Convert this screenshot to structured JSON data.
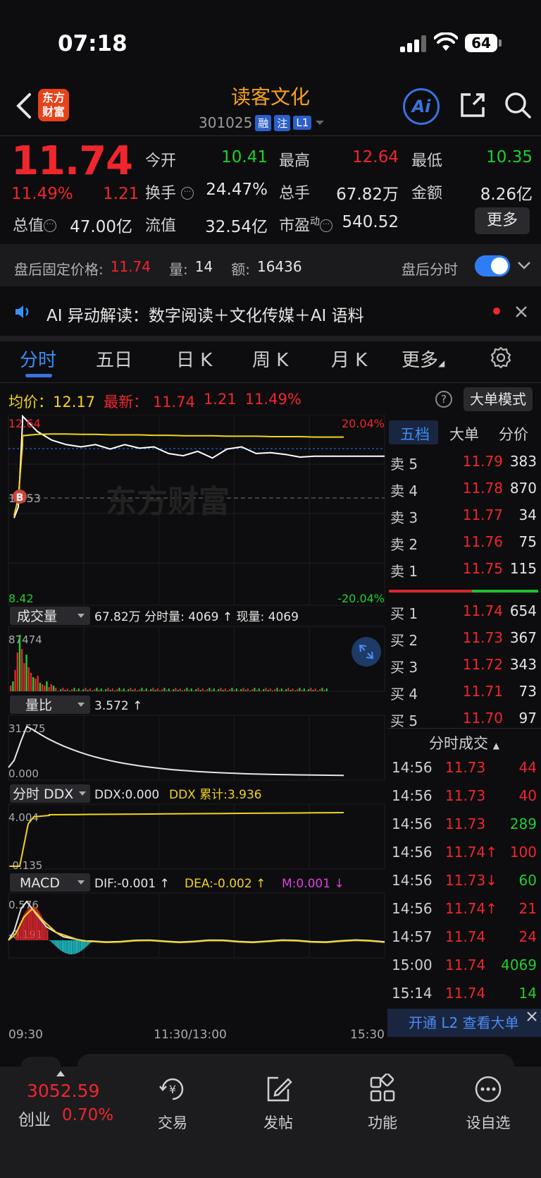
{
  "status_bar": {
    "time": "07:18",
    "battery": "64"
  },
  "header": {
    "logo_text_1": "东方",
    "logo_text_2": "财富",
    "stock_name": "读客文化",
    "stock_code": "301025",
    "tags": [
      "融",
      "注",
      "L1"
    ],
    "ai_label": "Ai"
  },
  "quote": {
    "price": "11.74",
    "change_pct": "11.49%",
    "change": "1.21",
    "open_label": "今开",
    "open": "10.41",
    "high_label": "最高",
    "high": "12.64",
    "low_label": "最低",
    "low": "10.35",
    "turnover_label": "换手",
    "turnover": "24.47%",
    "volume_label": "总手",
    "volume": "67.82万",
    "amount_label": "金额",
    "amount": "8.26亿",
    "mcap_label": "总值",
    "mcap": "47.00亿",
    "float_label": "流值",
    "float": "32.54亿",
    "pe_label": "市盈",
    "pe_sup": "动",
    "pe": "540.52",
    "more": "更多"
  },
  "after_hours": {
    "label": "盘后固定价格:",
    "price": "11.74",
    "vol_label": "量:",
    "vol": "14",
    "amt_label": "额:",
    "amt": "16436",
    "toggle_label": "盘后分时"
  },
  "ai_banner": {
    "text": "AI 异动解读：数字阅读＋文化传媒＋AI 语料"
  },
  "tabs": [
    "分时",
    "五日",
    "日 K",
    "周 K",
    "月 K",
    "更多"
  ],
  "info": {
    "avg_label": "均价：",
    "avg": "12.17",
    "latest_label": "最新：",
    "latest": "11.74",
    "chg": "1.21",
    "pct": "11.49%",
    "help": "?",
    "big_order_mode": "大单模式"
  },
  "chart_data": [
    {
      "type": "line",
      "name": "分时",
      "ylim": [
        8.42,
        12.64
      ],
      "ytick_left": [
        "12.64",
        "10.53",
        "8.42"
      ],
      "ytick_right": [
        "20.04%",
        "-20.04%"
      ],
      "marker": "B",
      "watermark": "东方财富",
      "x_labels": [
        "09:30",
        "11:30/13:00",
        "15:30"
      ],
      "series": [
        {
          "name": "price",
          "values": [
            10.35,
            10.6,
            12.5,
            12.64,
            12.3,
            12.1,
            12.0,
            11.95,
            12.0,
            11.9,
            12.0,
            11.92,
            11.95,
            11.8,
            11.75,
            11.85,
            11.7,
            11.9,
            11.95,
            11.8,
            11.82,
            11.78,
            11.72,
            11.74,
            11.74,
            11.74
          ]
        },
        {
          "name": "avg",
          "values": [
            10.4,
            10.8,
            12.0,
            12.2,
            12.23,
            12.24,
            12.24,
            12.23,
            12.23,
            12.22,
            12.22,
            12.22,
            12.21,
            12.21,
            12.2,
            12.2,
            12.2,
            12.19,
            12.19,
            12.19,
            12.18,
            12.18,
            12.18,
            12.17,
            12.17,
            12.17
          ]
        }
      ]
    },
    {
      "type": "bar",
      "name": "成交量",
      "legend": "67.82万 分时量: 4069 ↑ 现量: 4069",
      "ytick": "87474",
      "ylim": [
        0,
        87474
      ]
    },
    {
      "type": "line",
      "name": "量比",
      "legend": "3.572 ↑",
      "ytick_top": "31.575",
      "ytick_bottom": "0.000",
      "ylim": [
        0,
        31.575
      ]
    },
    {
      "type": "line",
      "name": "分时 DDX",
      "legend_ddx": "DDX:0.000",
      "legend_sum": "DDX 累计:3.936",
      "ytick_top": "4.004",
      "ytick_bottom": "-0.135",
      "ylim": [
        -0.135,
        4.004
      ]
    },
    {
      "type": "line",
      "name": "MACD",
      "legend_dif": "DIF:-0.001 ↑",
      "legend_dea": "DEA:-0.002 ↑",
      "legend_m": "M:0.001 ↓",
      "ytick_top": "0.576",
      "ytick_bottom": "-0.191",
      "ylim": [
        -0.191,
        0.576
      ]
    }
  ],
  "right_panel": {
    "tabs": [
      "五档",
      "大单",
      "分价"
    ],
    "asks": [
      {
        "label": "卖 5",
        "price": "11.79",
        "vol": "383"
      },
      {
        "label": "卖 4",
        "price": "11.78",
        "vol": "870"
      },
      {
        "label": "卖 3",
        "price": "11.77",
        "vol": "34"
      },
      {
        "label": "卖 2",
        "price": "11.76",
        "vol": "75"
      },
      {
        "label": "卖 1",
        "price": "11.75",
        "vol": "115"
      }
    ],
    "bids": [
      {
        "label": "买 1",
        "price": "11.74",
        "vol": "654"
      },
      {
        "label": "买 2",
        "price": "11.73",
        "vol": "367"
      },
      {
        "label": "买 3",
        "price": "11.72",
        "vol": "343"
      },
      {
        "label": "买 4",
        "price": "11.71",
        "vol": "73"
      },
      {
        "label": "买 5",
        "price": "11.70",
        "vol": "97"
      }
    ],
    "trades_title": "分时成交",
    "trades": [
      {
        "time": "14:56",
        "price": "11.73",
        "vol": "44",
        "dir": ""
      },
      {
        "time": "14:56",
        "price": "11.73",
        "vol": "40",
        "dir": ""
      },
      {
        "time": "14:56",
        "price": "11.73",
        "vol": "289",
        "dir": ""
      },
      {
        "time": "14:56",
        "price": "11.74↑",
        "vol": "100",
        "dir": "up"
      },
      {
        "time": "14:56",
        "price": "11.73↓",
        "vol": "60",
        "dir": "down"
      },
      {
        "time": "14:56",
        "price": "11.74↑",
        "vol": "21",
        "dir": "up"
      },
      {
        "time": "14:57",
        "price": "11.74",
        "vol": "24",
        "dir": ""
      },
      {
        "time": "15:00",
        "price": "11.74",
        "vol": "4069",
        "dir": ""
      },
      {
        "time": "15:14",
        "price": "11.74",
        "vol": "14",
        "dir": ""
      }
    ],
    "l2_banner": "开通 L2 查看大单"
  },
  "bottom_nav": {
    "index_value": "3052.59",
    "index_name": "创业",
    "index_pct": "0.70%",
    "items": [
      "交易",
      "发帖",
      "功能",
      "设自选"
    ]
  }
}
